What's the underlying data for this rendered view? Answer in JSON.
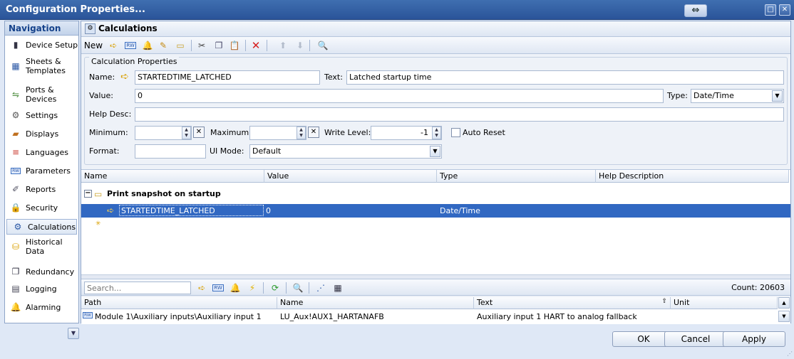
{
  "window": {
    "title": "Configuration Properties..."
  },
  "nav": {
    "header": "Navigation",
    "items": [
      {
        "label": "Device Setup",
        "icon": "device-icon"
      },
      {
        "label": "Sheets &\nTemplates",
        "icon": "sheets-icon"
      },
      {
        "label": "Ports &\nDevices",
        "icon": "ports-icon"
      },
      {
        "label": "Settings",
        "icon": "settings-icon"
      },
      {
        "label": "Displays",
        "icon": "displays-icon"
      },
      {
        "label": "Languages",
        "icon": "languages-icon"
      },
      {
        "label": "Parameters",
        "icon": "rw-icon"
      },
      {
        "label": "Reports",
        "icon": "reports-icon"
      },
      {
        "label": "Security",
        "icon": "lock-icon"
      },
      {
        "label": "Calculations",
        "icon": "calculations-icon"
      },
      {
        "label": "Historical\nData",
        "icon": "historical-icon"
      },
      {
        "label": "Redundancy",
        "icon": "redundancy-icon"
      },
      {
        "label": "Logging",
        "icon": "logging-icon"
      },
      {
        "label": "Alarming",
        "icon": "alarm-icon"
      }
    ]
  },
  "panel": {
    "title": "Calculations"
  },
  "toolbar": {
    "new_label": "New"
  },
  "props": {
    "legend": "Calculation Properties",
    "name_label": "Name:",
    "name_value": "STARTEDTIME_LATCHED",
    "text_label": "Text:",
    "text_value": "Latched startup time",
    "value_label": "Value:",
    "value_value": "0",
    "type_label": "Type:",
    "type_value": "Date/Time",
    "help_label": "Help Desc:",
    "help_value": "",
    "min_label": "Minimum:",
    "min_value": "",
    "max_label": "Maximum:",
    "max_value": "",
    "write_label": "Write Level:",
    "write_value": "-1",
    "autoreset_label": "Auto Reset",
    "format_label": "Format:",
    "format_value": "",
    "uimode_label": "UI Mode:",
    "uimode_value": "Default"
  },
  "grid": {
    "columns": [
      "Name",
      "Value",
      "Type",
      "Help Description"
    ],
    "group": "Print snapshot on startup",
    "row": {
      "name": "STARTEDTIME_LATCHED",
      "value": "0",
      "type": "Date/Time",
      "help": ""
    }
  },
  "search": {
    "placeholder": "Search...",
    "count": "Count: 20603"
  },
  "bottom": {
    "columns": [
      "Path",
      "Name",
      "Text",
      "Unit"
    ],
    "row": {
      "path": "Module 1\\Auxiliary inputs\\Auxiliary input 1",
      "name": "LU_Aux!AUX1_HARTANAFB",
      "text": "Auxiliary input 1 HART to analog fallback",
      "unit": ""
    }
  },
  "buttons": {
    "ok": "OK",
    "cancel": "Cancel",
    "apply": "Apply"
  },
  "colors": {
    "selection": "#3168c2",
    "titlebar": "#2a5499"
  }
}
